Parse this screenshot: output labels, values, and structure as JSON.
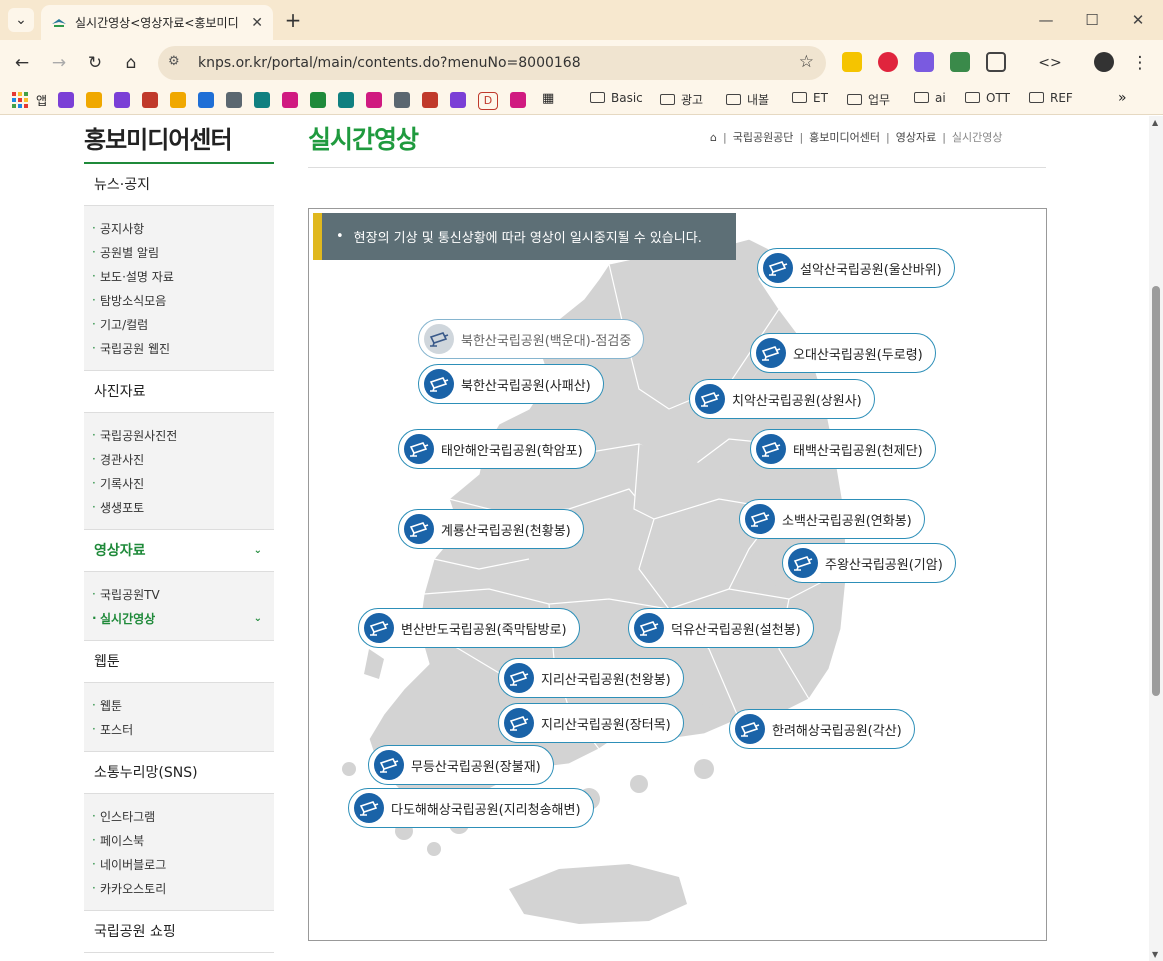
{
  "browser": {
    "tab_title": "실시간영상<영상자료<홍보미디",
    "url": "knps.or.kr/portal/main/contents.do?menuNo=8000168",
    "bookmarks_apps_label": "앱",
    "bookmark_d_label": "D",
    "bookmark_folders": [
      "Basic",
      "광고",
      "내볼",
      "ET",
      "업무",
      "ai",
      "OTT",
      "REF"
    ],
    "bookmark_square_colors": [
      "#7b3fd6",
      "#f0a800",
      "#7b3fd6",
      "#c0392b",
      "#f0a800",
      "#1f6fd6",
      "#5b6770",
      "#108080",
      "#d01a80",
      "#1f8a3a",
      "#108080",
      "#d01a80",
      "#5b6770",
      "#c0392b",
      "#7b3fd6"
    ]
  },
  "sidebar": {
    "title": "홍보미디어센터",
    "sections": [
      {
        "label": "뉴스·공지",
        "items": [
          "공지사항",
          "공원별 알림",
          "보도·설명 자료",
          "탐방소식모음",
          "기고/컬럼",
          "국립공원 웹진"
        ]
      },
      {
        "label": "사진자료",
        "items": [
          "국립공원사진전",
          "경관사진",
          "기록사진",
          "생생포토"
        ]
      },
      {
        "label": "영상자료",
        "items": [
          "국립공원TV",
          "실시간영상"
        ]
      },
      {
        "label": "웹툰",
        "items": [
          "웹툰",
          "포스터"
        ]
      },
      {
        "label": "소통누리망(SNS)",
        "items": [
          "인스타그램",
          "페이스북",
          "네이버블로그",
          "카카오스토리"
        ]
      },
      {
        "label": "국립공원 쇼핑",
        "items": []
      }
    ]
  },
  "main": {
    "page_title": "실시간영상",
    "breadcrumb": [
      "국립공원공단",
      "홍보미디어센터",
      "영상자료",
      "실시간영상"
    ],
    "notice": "현장의 기상 및 통신상황에 따라 영상이 일시중지될 수 있습니다.",
    "cameras": [
      {
        "label": "설악산국립공원(울산바위)",
        "status": "active"
      },
      {
        "label": "북한산국립공원(백운대)-점검중",
        "status": "inspection"
      },
      {
        "label": "오대산국립공원(두로령)",
        "status": "active"
      },
      {
        "label": "북한산국립공원(사패산)",
        "status": "active"
      },
      {
        "label": "치악산국립공원(상원사)",
        "status": "active"
      },
      {
        "label": "태안해안국립공원(학암포)",
        "status": "active"
      },
      {
        "label": "태백산국립공원(천제단)",
        "status": "active"
      },
      {
        "label": "소백산국립공원(연화봉)",
        "status": "active"
      },
      {
        "label": "계룡산국립공원(천황봉)",
        "status": "active"
      },
      {
        "label": "주왕산국립공원(기암)",
        "status": "active"
      },
      {
        "label": "변산반도국립공원(죽막탐방로)",
        "status": "active"
      },
      {
        "label": "덕유산국립공원(설천봉)",
        "status": "active"
      },
      {
        "label": "지리산국립공원(천왕봉)",
        "status": "active"
      },
      {
        "label": "지리산국립공원(장터목)",
        "status": "active"
      },
      {
        "label": "한려해상국립공원(각산)",
        "status": "active"
      },
      {
        "label": "무등산국립공원(장불재)",
        "status": "active"
      },
      {
        "label": "다도해해상국립공원(지리청송해변)",
        "status": "active"
      }
    ]
  },
  "colors": {
    "brand_green": "#1f9a3e",
    "camera_blue": "#1a63a8",
    "notice_bg": "#5d6f76",
    "notice_accent": "#e0b81e"
  }
}
